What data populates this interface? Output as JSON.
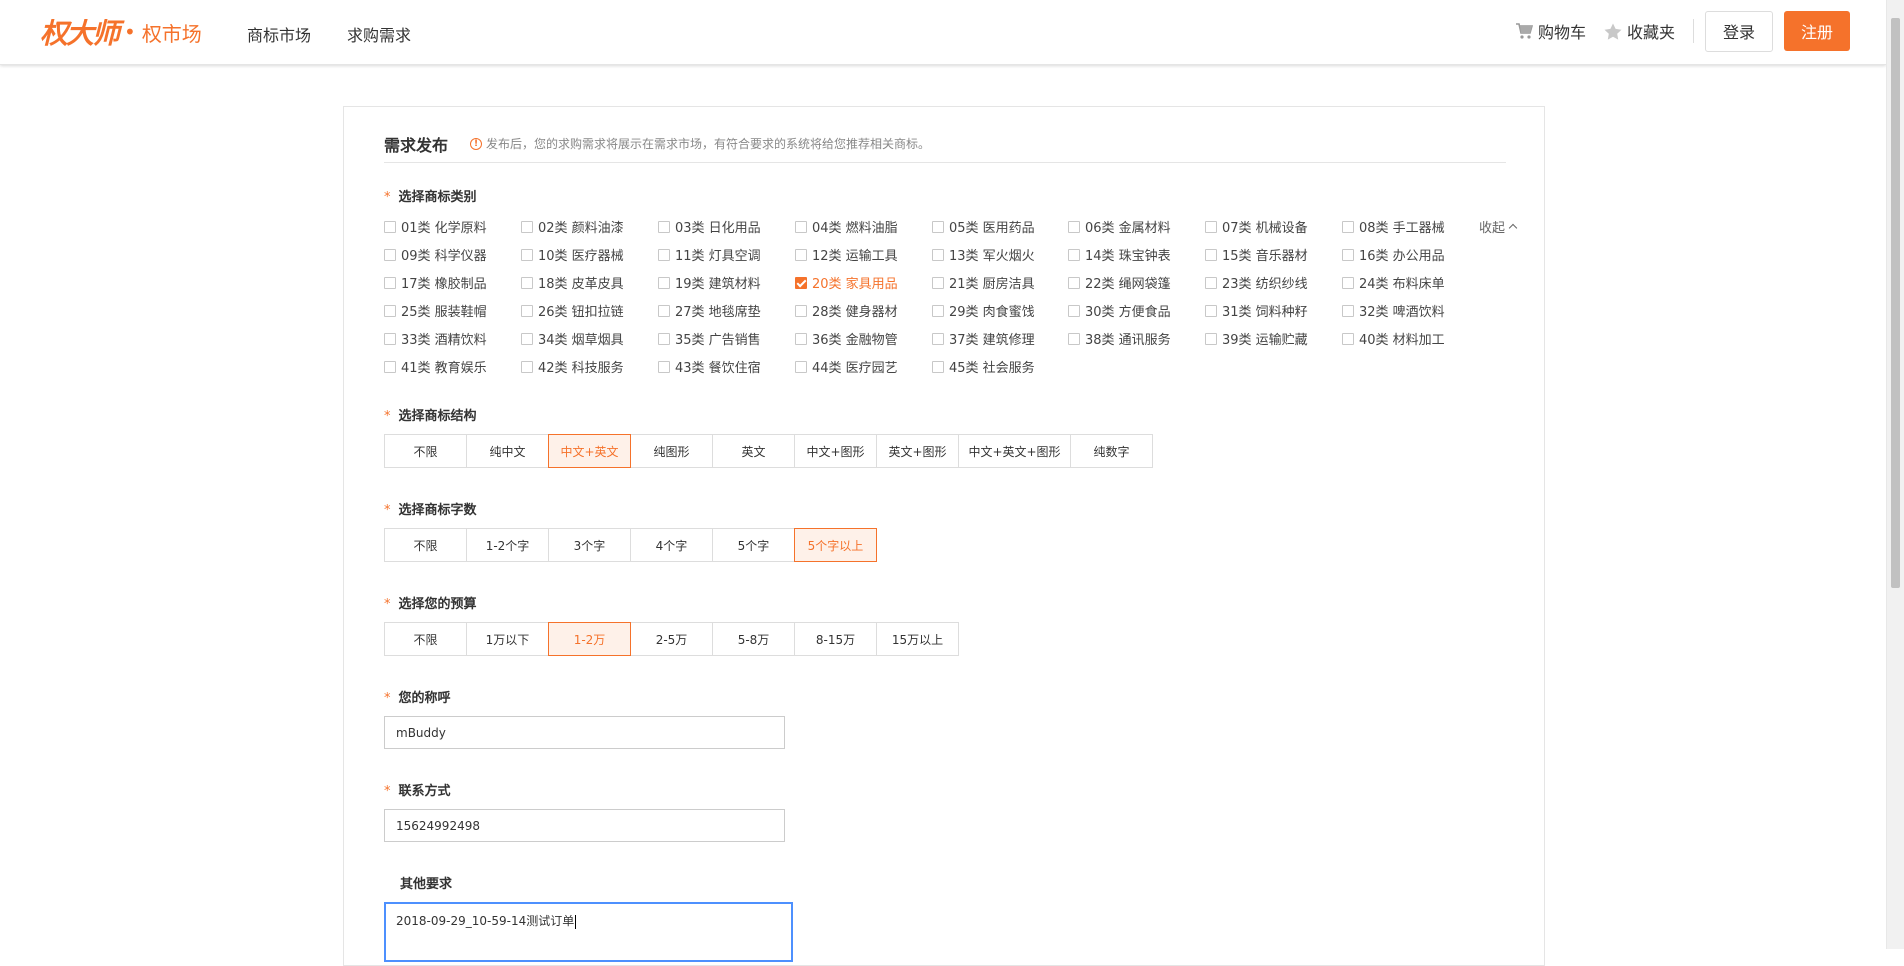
{
  "header": {
    "logo_script": "权大师",
    "logo_dot": "•",
    "logo_sub": "权市场",
    "nav": [
      "商标市场",
      "求购需求"
    ],
    "cart": "购物车",
    "favorites": "收藏夹",
    "login": "登录",
    "register": "注册"
  },
  "form": {
    "title": "需求发布",
    "tip_icon": "!",
    "tip": "发布后，您的求购需求将展示在需求市场，有符合要求的系统将给您推荐相关商标。",
    "required_mark": "*",
    "category_label": "选择商标类别",
    "collapse": "收起",
    "categories": [
      {
        "text": "01类 化学原料",
        "checked": false
      },
      {
        "text": "02类 颜料油漆",
        "checked": false
      },
      {
        "text": "03类 日化用品",
        "checked": false
      },
      {
        "text": "04类 燃料油脂",
        "checked": false
      },
      {
        "text": "05类 医用药品",
        "checked": false
      },
      {
        "text": "06类 金属材料",
        "checked": false
      },
      {
        "text": "07类 机械设备",
        "checked": false
      },
      {
        "text": "08类 手工器械",
        "checked": false
      },
      {
        "text": "09类 科学仪器",
        "checked": false
      },
      {
        "text": "10类 医疗器械",
        "checked": false
      },
      {
        "text": "11类 灯具空调",
        "checked": false
      },
      {
        "text": "12类 运输工具",
        "checked": false
      },
      {
        "text": "13类 军火烟火",
        "checked": false
      },
      {
        "text": "14类 珠宝钟表",
        "checked": false
      },
      {
        "text": "15类 音乐器材",
        "checked": false
      },
      {
        "text": "16类 办公用品",
        "checked": false
      },
      {
        "text": "17类 橡胶制品",
        "checked": false
      },
      {
        "text": "18类 皮革皮具",
        "checked": false
      },
      {
        "text": "19类 建筑材料",
        "checked": false
      },
      {
        "text": "20类 家具用品",
        "checked": true
      },
      {
        "text": "21类 厨房洁具",
        "checked": false
      },
      {
        "text": "22类 绳网袋篷",
        "checked": false
      },
      {
        "text": "23类 纺织纱线",
        "checked": false
      },
      {
        "text": "24类 布料床单",
        "checked": false
      },
      {
        "text": "25类 服装鞋帽",
        "checked": false
      },
      {
        "text": "26类 钮扣拉链",
        "checked": false
      },
      {
        "text": "27类 地毯席垫",
        "checked": false
      },
      {
        "text": "28类 健身器材",
        "checked": false
      },
      {
        "text": "29类 肉食蜜饯",
        "checked": false
      },
      {
        "text": "30类 方便食品",
        "checked": false
      },
      {
        "text": "31类 饲料种籽",
        "checked": false
      },
      {
        "text": "32类 啤酒饮料",
        "checked": false
      },
      {
        "text": "33类 酒精饮料",
        "checked": false
      },
      {
        "text": "34类 烟草烟具",
        "checked": false
      },
      {
        "text": "35类 广告销售",
        "checked": false
      },
      {
        "text": "36类 金融物管",
        "checked": false
      },
      {
        "text": "37类 建筑修理",
        "checked": false
      },
      {
        "text": "38类 通讯服务",
        "checked": false
      },
      {
        "text": "39类 运输贮藏",
        "checked": false
      },
      {
        "text": "40类 材料加工",
        "checked": false
      },
      {
        "text": "41类 教育娱乐",
        "checked": false
      },
      {
        "text": "42类 科技服务",
        "checked": false
      },
      {
        "text": "43类 餐饮住宿",
        "checked": false
      },
      {
        "text": "44类 医疗园艺",
        "checked": false
      },
      {
        "text": "45类 社会服务",
        "checked": false
      }
    ],
    "structure_label": "选择商标结构",
    "structure_options": [
      "不限",
      "纯中文",
      "中文+英文",
      "纯图形",
      "英文",
      "中文+图形",
      "英文+图形",
      "中文+英文+图形",
      "纯数字"
    ],
    "structure_selected": "中文+英文",
    "length_label": "选择商标字数",
    "length_options": [
      "不限",
      "1-2个字",
      "3个字",
      "4个字",
      "5个字",
      "5个字以上"
    ],
    "length_selected": "5个字以上",
    "budget_label": "选择您的预算",
    "budget_options": [
      "不限",
      "1万以下",
      "1-2万",
      "2-5万",
      "5-8万",
      "8-15万",
      "15万以上"
    ],
    "budget_selected": "1-2万",
    "name_label": "您的称呼",
    "name_value": "mBuddy",
    "contact_label": "联系方式",
    "contact_value": "15624992498",
    "other_label": "其他要求",
    "other_value": "2018-09-29_10-59-14测试订单"
  }
}
